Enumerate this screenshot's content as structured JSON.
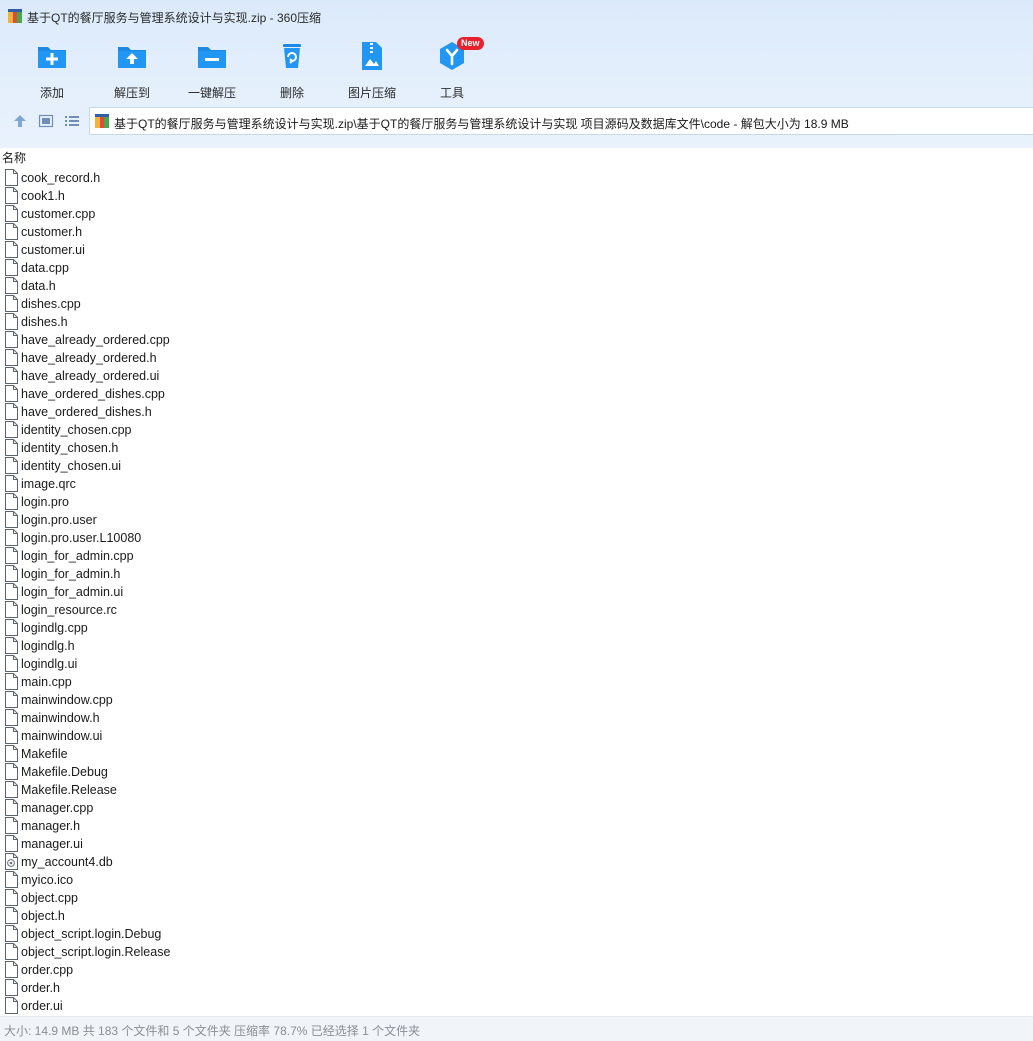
{
  "window": {
    "title": "基于QT的餐厅服务与管理系统设计与实现.zip - 360压缩"
  },
  "toolbar": {
    "items": [
      {
        "label": "添加",
        "icon": "add-icon"
      },
      {
        "label": "解压到",
        "icon": "extract-to-icon"
      },
      {
        "label": "一键解压",
        "icon": "one-click-extract-icon"
      },
      {
        "label": "删除",
        "icon": "delete-icon"
      },
      {
        "label": "图片压缩",
        "icon": "image-compress-icon"
      },
      {
        "label": "工具",
        "icon": "tools-icon",
        "badge": "New"
      }
    ]
  },
  "nav": {
    "address": "基于QT的餐厅服务与管理系统设计与实现.zip\\基于QT的餐厅服务与管理系统设计与实现 项目源码及数据库文件\\code - 解包大小为 18.9 MB"
  },
  "list": {
    "column_name": "名称",
    "files": [
      "cook_record.h",
      "cook1.h",
      "customer.cpp",
      "customer.h",
      "customer.ui",
      "data.cpp",
      "data.h",
      "dishes.cpp",
      "dishes.h",
      "have_already_ordered.cpp",
      "have_already_ordered.h",
      "have_already_ordered.ui",
      "have_ordered_dishes.cpp",
      "have_ordered_dishes.h",
      "identity_chosen.cpp",
      "identity_chosen.h",
      "identity_chosen.ui",
      "image.qrc",
      "login.pro",
      "login.pro.user",
      "login.pro.user.L10080",
      "login_for_admin.cpp",
      "login_for_admin.h",
      "login_for_admin.ui",
      "login_resource.rc",
      "logindlg.cpp",
      "logindlg.h",
      "logindlg.ui",
      "main.cpp",
      "mainwindow.cpp",
      "mainwindow.h",
      "mainwindow.ui",
      "Makefile",
      "Makefile.Debug",
      "Makefile.Release",
      "manager.cpp",
      "manager.h",
      "manager.ui",
      "my_account4.db",
      "myico.ico",
      "object.cpp",
      "object.h",
      "object_script.login.Debug",
      "object_script.login.Release",
      "order.cpp",
      "order.h",
      "order.ui"
    ]
  },
  "status": {
    "text": "大小: 14.9 MB 共 183 个文件和 5 个文件夹 压缩率 78.7% 已经选择 1 个文件夹"
  },
  "colors": {
    "accent": "#1e88e5",
    "toolbar_bg": "#e4effc",
    "badge": "#e8212c"
  }
}
